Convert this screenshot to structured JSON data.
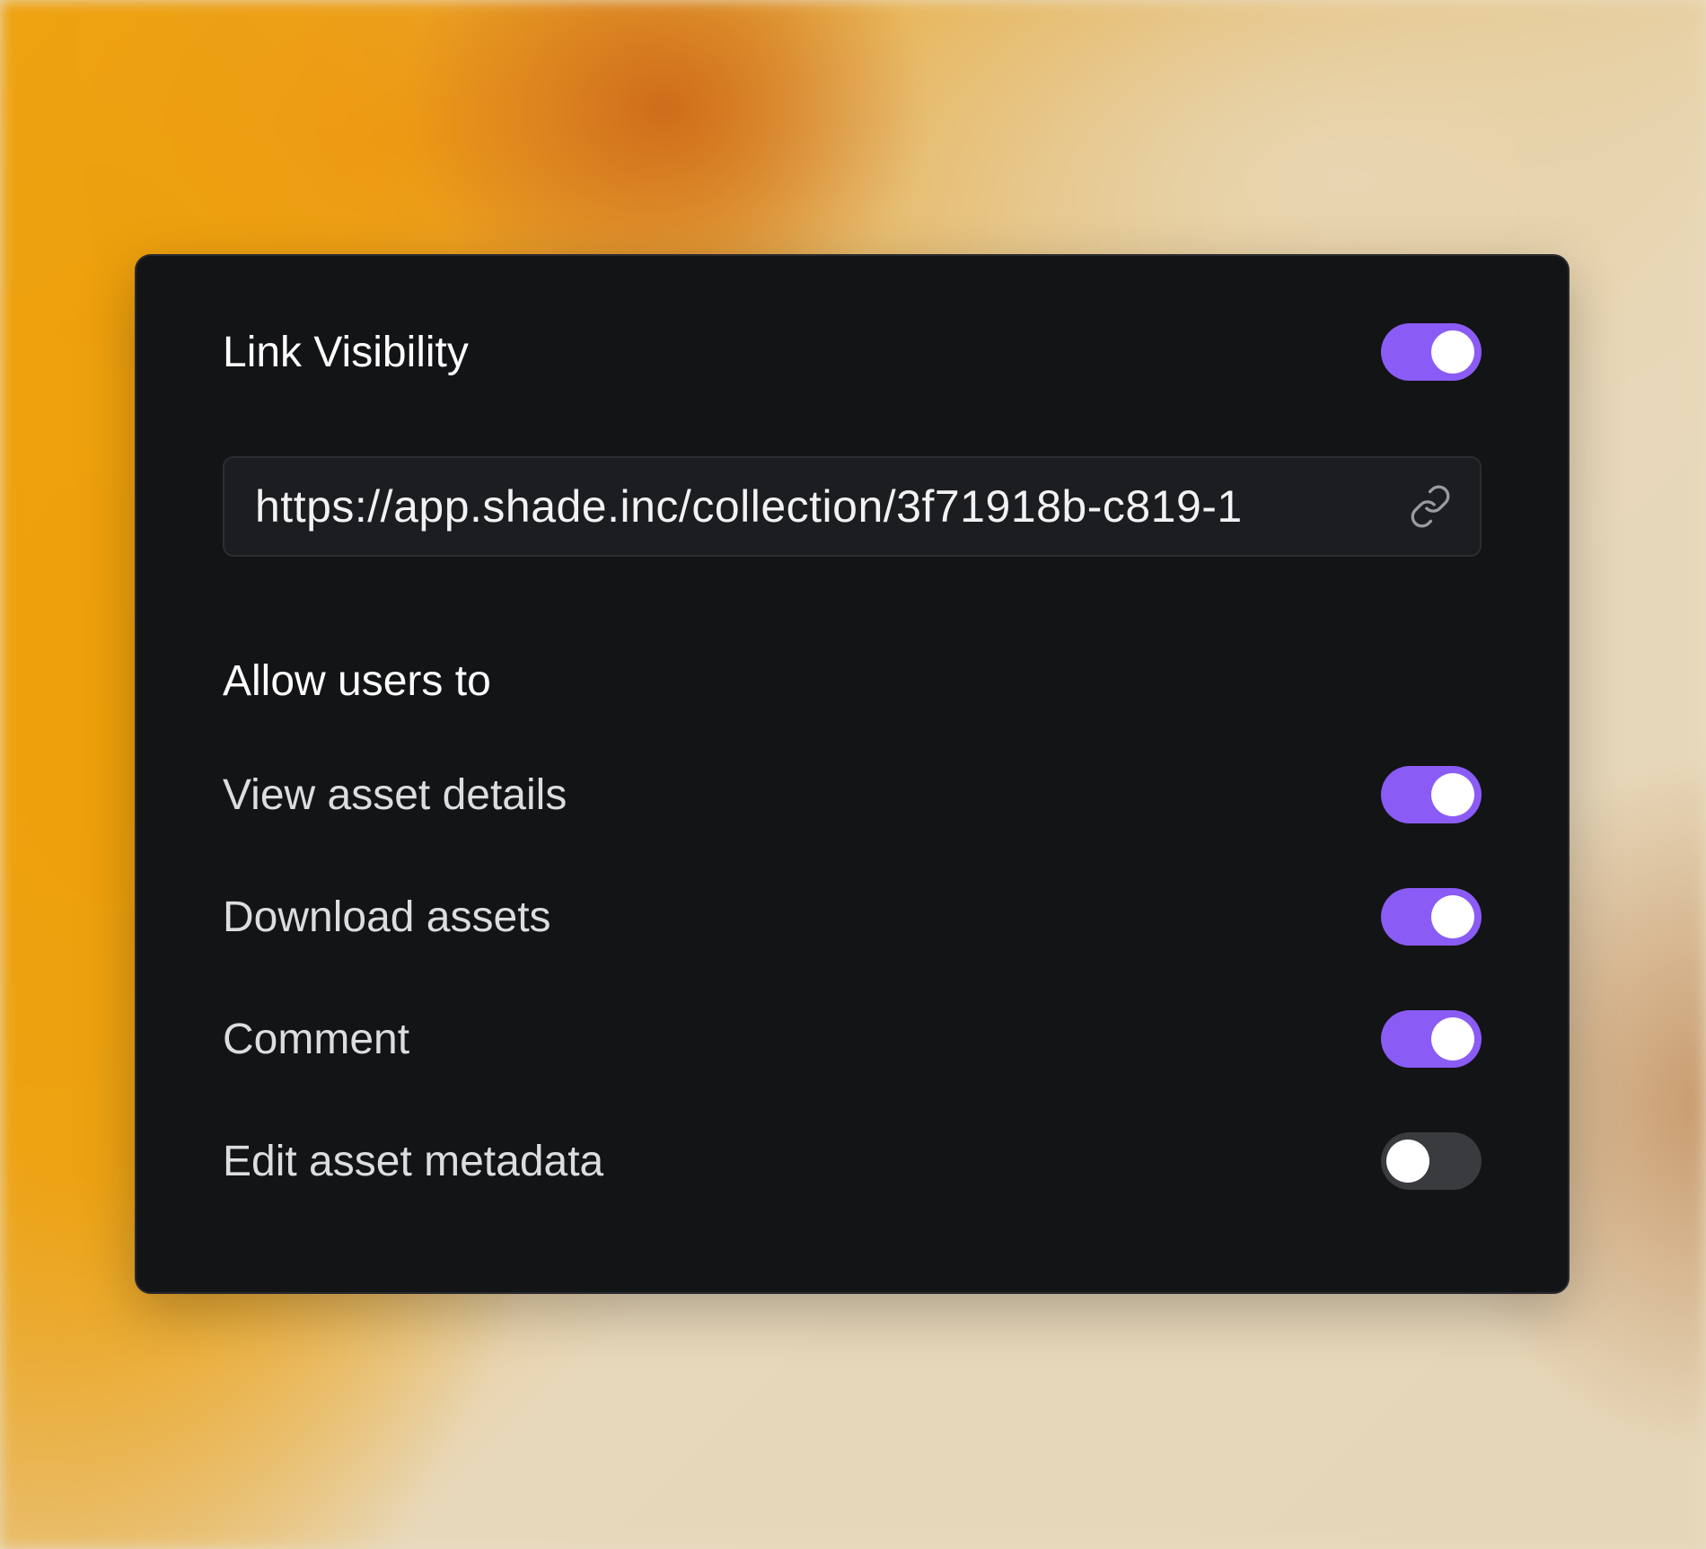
{
  "link_visibility": {
    "title": "Link Visibility",
    "enabled": true
  },
  "share_url": {
    "value": "https://app.shade.inc/collection/3f71918b-c819-1",
    "icon": "link-icon"
  },
  "permissions": {
    "heading": "Allow users to",
    "items": [
      {
        "label": "View asset details",
        "enabled": true
      },
      {
        "label": "Download assets",
        "enabled": true
      },
      {
        "label": "Comment",
        "enabled": true
      },
      {
        "label": "Edit asset metadata",
        "enabled": false
      }
    ]
  },
  "colors": {
    "accent": "#8a5cf5",
    "card": "#131416",
    "toggle_off": "#3a3b3f"
  }
}
